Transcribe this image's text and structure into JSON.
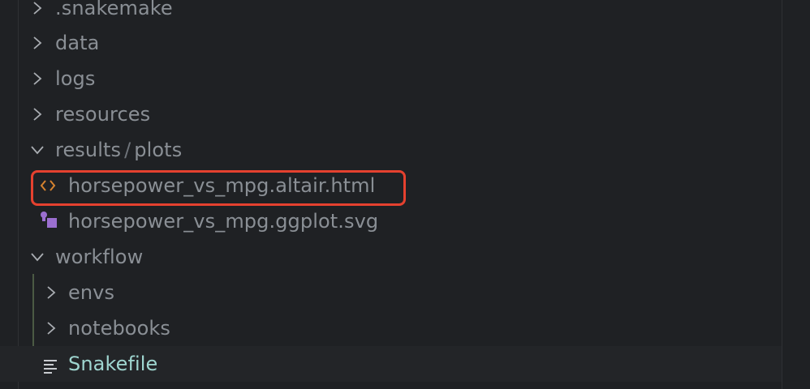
{
  "explorer": {
    "items": [
      {
        "label": ".snakemake",
        "type": "folder",
        "expanded": false
      },
      {
        "label": "data",
        "type": "folder",
        "expanded": false
      },
      {
        "label": "logs",
        "type": "folder",
        "expanded": false
      },
      {
        "label": "resources",
        "type": "folder",
        "expanded": false
      },
      {
        "label": "results",
        "label_part2": "plots",
        "type": "folder",
        "expanded": true
      },
      {
        "label": "horsepower_vs_mpg.altair.html",
        "type": "file",
        "icon": "html-code-icon",
        "icon_color": "#d7832f"
      },
      {
        "label": "horsepower_vs_mpg.ggplot.svg",
        "type": "file",
        "icon": "svg-shapes-icon",
        "icon_color": "#9b6fd0"
      },
      {
        "label": "workflow",
        "type": "folder",
        "expanded": true
      },
      {
        "label": "envs",
        "type": "folder",
        "expanded": false
      },
      {
        "label": "notebooks",
        "type": "folder",
        "expanded": false
      },
      {
        "label": "Snakefile",
        "type": "file",
        "icon": "text-lines-icon",
        "selected": true
      }
    ]
  },
  "colors": {
    "background": "#1f2124",
    "text": "#8a8f95",
    "selected_text": "#9fd6d0",
    "highlight_border": "#e5412f"
  }
}
